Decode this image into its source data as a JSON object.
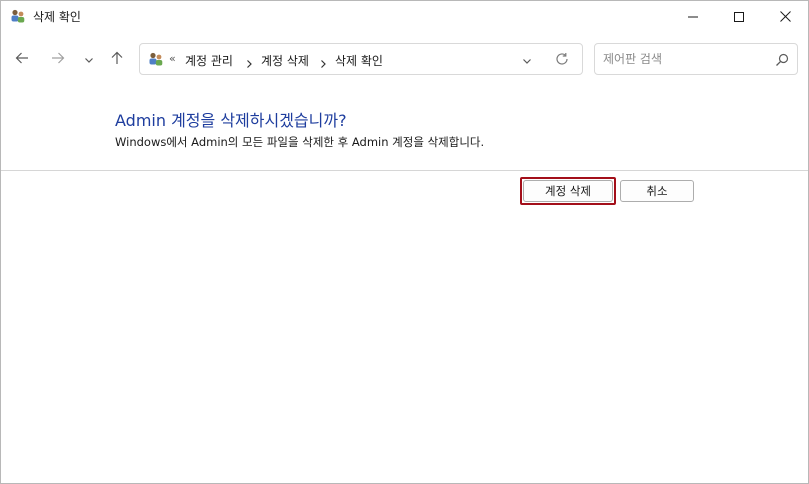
{
  "window": {
    "title": "삭제 확인",
    "accent_color": "#1e3d9e",
    "focus_ring_color": "#a30f1a"
  },
  "titlebar_buttons": {
    "minimize_icon": "minimize-icon",
    "maximize_icon": "maximize-icon",
    "close_icon": "close-icon"
  },
  "navigation": {
    "back_icon": "arrow-left-icon",
    "forward_icon": "arrow-right-icon",
    "recent_icon": "chevron-down-icon",
    "up_icon": "arrow-up-icon"
  },
  "address_bar": {
    "overflow_label": "«",
    "breadcrumbs": [
      "계정 관리",
      "계정 삭제",
      "삭제 확인"
    ],
    "location_icon": "user-accounts-icon"
  },
  "search": {
    "placeholder": "제어판 검색",
    "value": ""
  },
  "main": {
    "heading": "Admin 계정을 삭제하시겠습니까?",
    "description": "Windows에서 Admin의 모든 파일을 삭제한 후 Admin 계정을 삭제합니다.",
    "delete_button_label": "계정 삭제",
    "cancel_button_label": "취소"
  }
}
